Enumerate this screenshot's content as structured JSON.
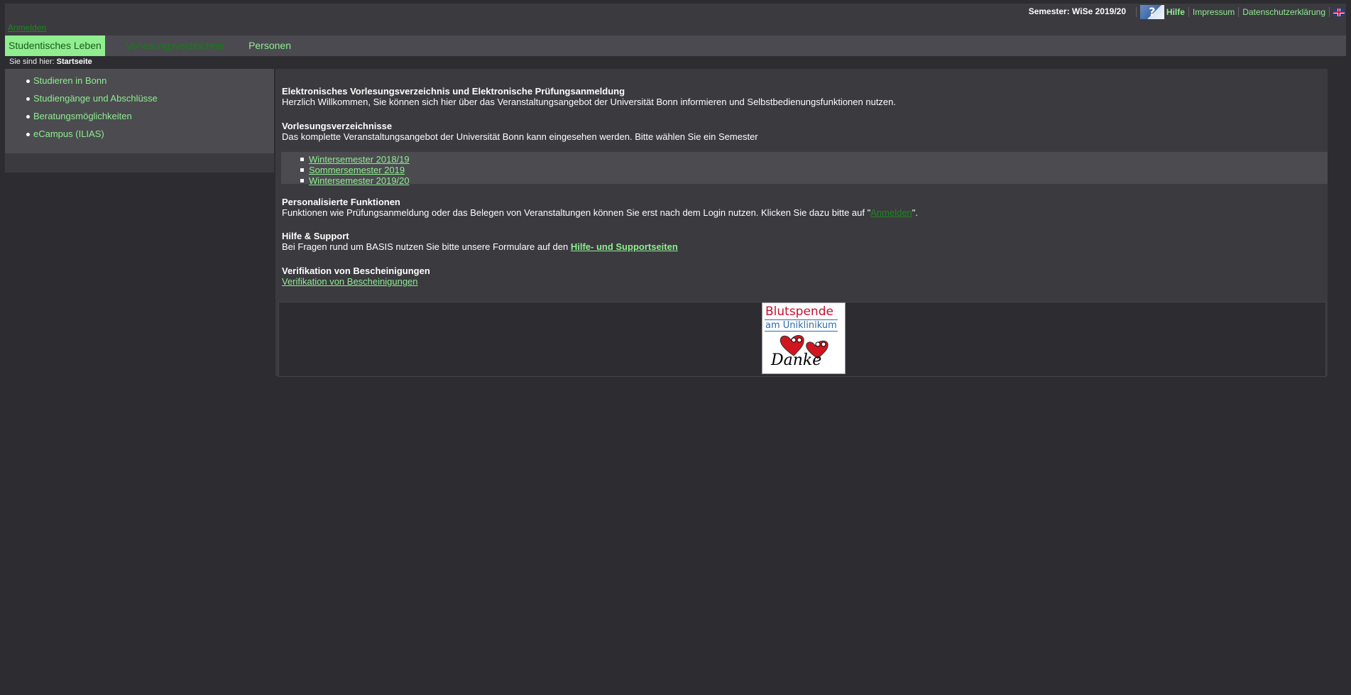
{
  "header": {
    "semester_label": "Semester: WiSe 2019/20",
    "help_label": "Hilfe",
    "impressum_label": "Impressum",
    "datenschutz_label": "Datenschutzerklärung",
    "login_label": "Anmelden"
  },
  "nav": {
    "tabs": [
      {
        "label": "Studentisches Leben"
      },
      {
        "label": "Vorlesungsverzeichnis"
      },
      {
        "label": "Personen"
      }
    ]
  },
  "breadcrumb": {
    "prefix": "Sie sind hier:",
    "current": "Startseite"
  },
  "sidebar": {
    "items": [
      {
        "label": "Studieren in Bonn"
      },
      {
        "label": "Studiengänge und Abschlüsse"
      },
      {
        "label": "Beratungsmöglichkeiten"
      },
      {
        "label": "eCampus (ILIAS)"
      }
    ]
  },
  "main": {
    "intro_heading": "Elektronisches Vorlesungsverzeichnis und Elektronische Prüfungsanmeldung",
    "intro_text": "Herzlich Willkommen, Sie können sich hier über das Veranstaltungsangebot der Universität Bonn informieren und Selbstbedienungsfunktionen nutzen.",
    "vv_heading": "Vorlesungsverzeichnisse",
    "vv_text": "Das komplette Veranstaltungsangebot der Universität Bonn kann eingesehen werden. Bitte wählen Sie ein Semester",
    "semesters": [
      {
        "label": "Wintersemester 2018/19"
      },
      {
        "label": "Sommersemester 2019"
      },
      {
        "label": "Wintersemester 2019/20"
      }
    ],
    "pers_heading": "Personalisierte Funktionen",
    "pers_text_before": "Funktionen wie Prüfungsanmeldung oder das Belegen von Veranstaltungen können Sie erst nach dem Login nutzen. Klicken Sie dazu bitte auf \"",
    "pers_link": "Anmelden",
    "pers_text_after": "\".",
    "help_heading": "Hilfe & Support",
    "help_text": "Bei Fragen rund um BASIS nutzen Sie bitte unsere Formulare auf den ",
    "help_link": "Hilfe- und Supportseiten",
    "verif_heading": "Verifikation von Bescheinigungen",
    "verif_link": "Verifikation von Bescheinigungen"
  },
  "banner": {
    "line1": "Blutspende",
    "line2": "am Uniklinikum",
    "line3": "Danke"
  },
  "colors": {
    "background": "#2d2c31",
    "panel": "#3a3a3f",
    "link": "#90ee90",
    "active_tab": "#90ee90"
  }
}
